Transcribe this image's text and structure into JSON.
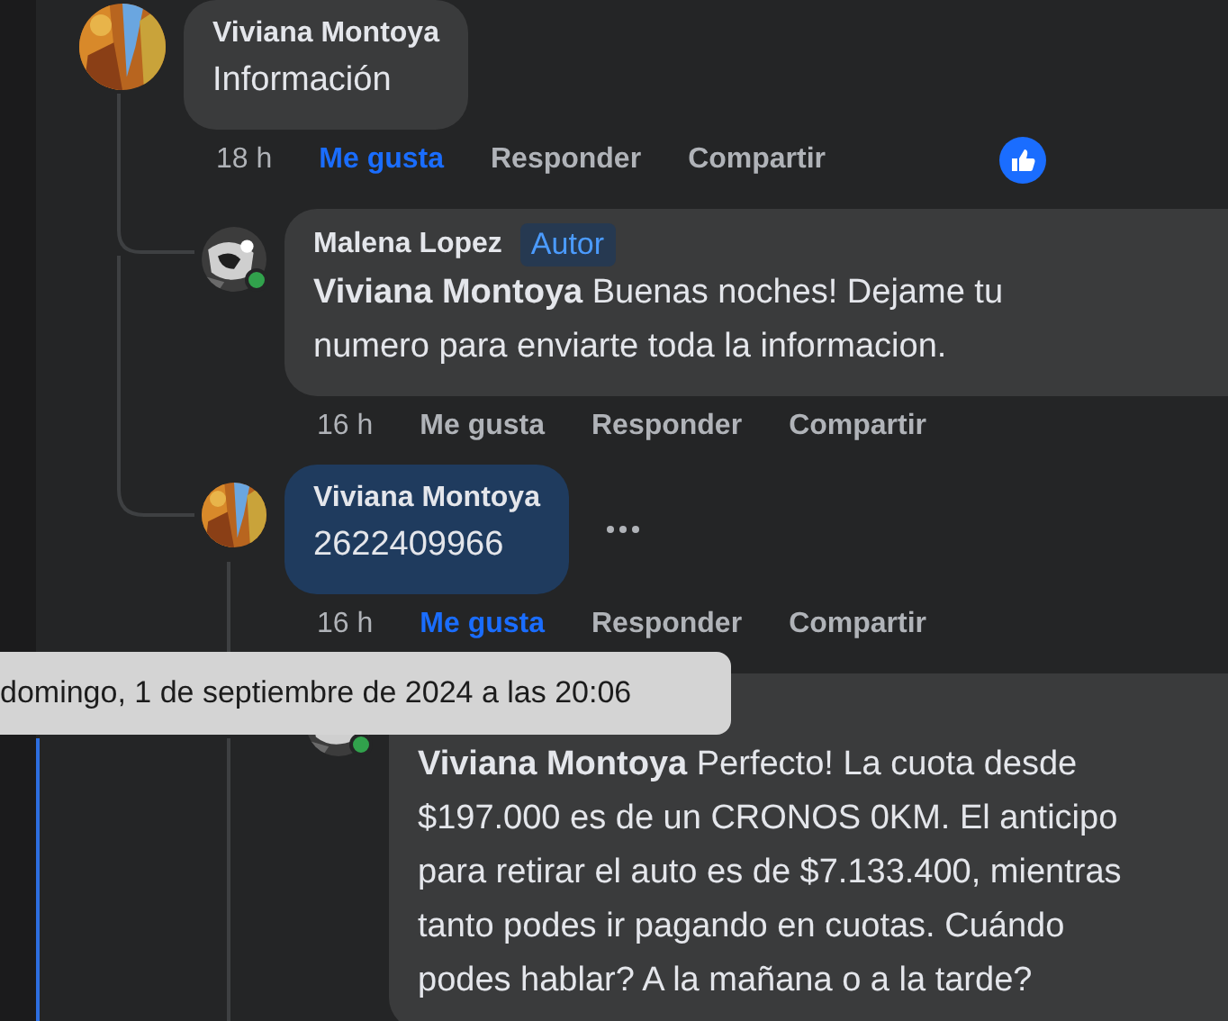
{
  "comments": [
    {
      "author": "Viviana Montoya",
      "online": false,
      "text": "Información",
      "time": "18 h",
      "actions": [
        "Me gusta",
        "Responder",
        "Compartir"
      ],
      "liked": true,
      "reacted": true,
      "highlighted": false,
      "children": [
        {
          "author": "Malena Lopez",
          "badge": "Autor",
          "online": true,
          "mention": "Viviana Montoya",
          "text": "Buenas noches! Dejame tu\nnumero para enviarte toda la informacion.",
          "time": "16 h",
          "actions": [
            "Me gusta",
            "Responder",
            "Compartir"
          ],
          "liked": false,
          "reacted": false,
          "highlighted": false
        },
        {
          "author": "Viviana Montoya",
          "online": false,
          "text": "2622409966",
          "time": "16 h",
          "actions": [
            "Me gusta",
            "Responder",
            "Compartir"
          ],
          "liked": true,
          "reacted": false,
          "highlighted": true,
          "children": [
            {
              "online": true,
              "mention": "Viviana Montoya",
              "text": "Perfecto! La cuota desde\n$197.000 es de un CRONOS 0KM. El anticipo\npara retirar el auto es de $7.133.400, mientras\ntanto podes ir pagando en cuotas. Cuándo\npodes hablar? A la mañana o a la tarde?",
              "highlighted": false
            }
          ]
        }
      ]
    }
  ],
  "tooltip": "domingo, 1 de septiembre de 2024 a las 20:06"
}
